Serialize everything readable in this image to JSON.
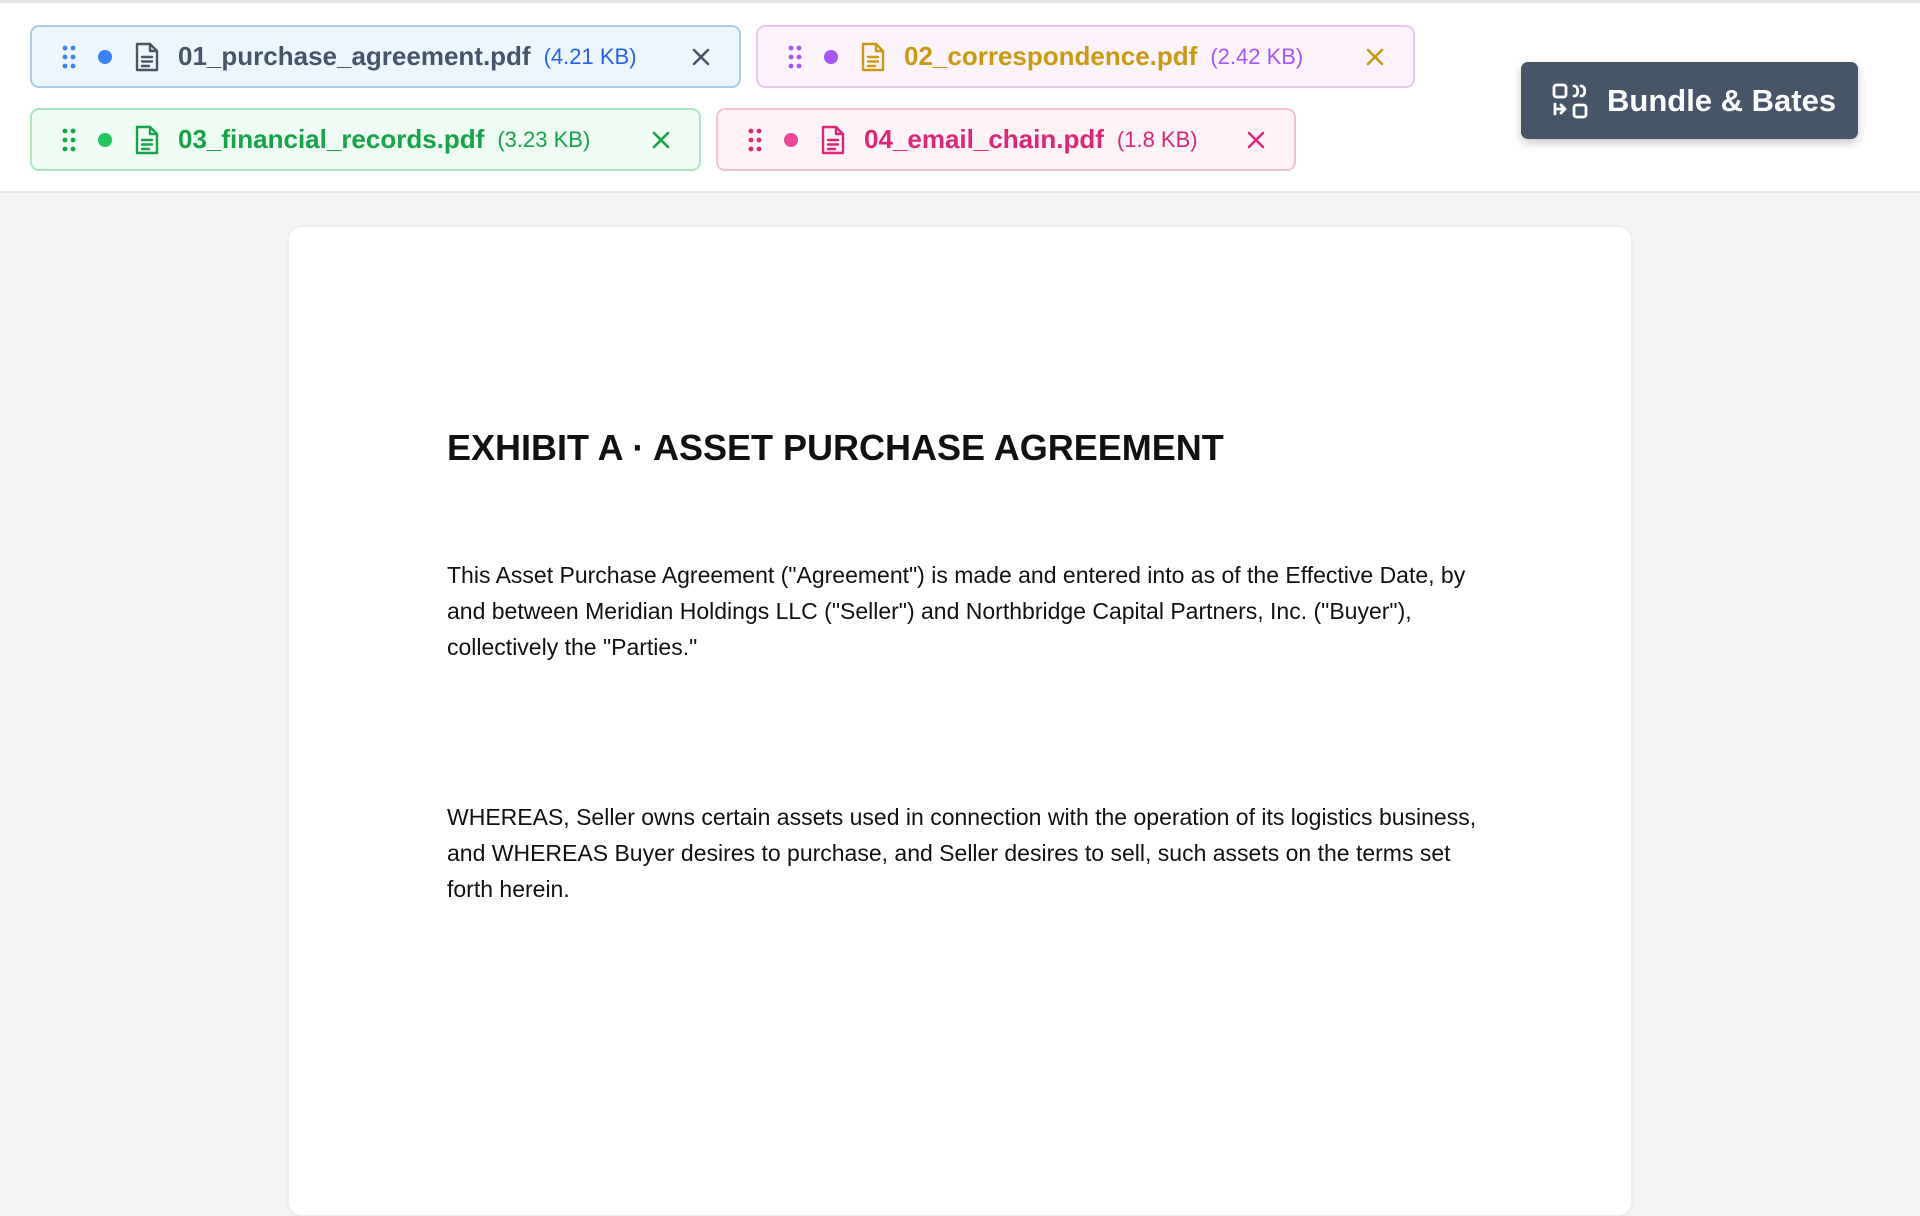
{
  "tabs": [
    {
      "name": "01_purchase_agreement.pdf",
      "size": "(4.21 KB)",
      "colors": {
        "bg": "#eef6fd",
        "border": "#a9cdee",
        "grip": "#3b82f6",
        "dot": "#3b82f6",
        "icon": "#4b5563",
        "name": "#475569",
        "size": "#2563eb",
        "close": "#475569"
      }
    },
    {
      "name": "02_correspondence.pdf",
      "size": "(2.42 KB)",
      "colors": {
        "bg": "#fcf3fd",
        "border": "#e9c7f0",
        "grip": "#a855f7",
        "dot": "#a855f7",
        "icon": "#ca9a12",
        "name": "#ca9a12",
        "size": "#a855f7",
        "close": "#ca9a12"
      }
    },
    {
      "name": "03_financial_records.pdf",
      "size": "(3.23 KB)",
      "colors": {
        "bg": "#effcf3",
        "border": "#a7e8bc",
        "grip": "#16a34a",
        "dot": "#22c55e",
        "icon": "#16a34a",
        "name": "#16a34a",
        "size": "#16a34a",
        "close": "#16a34a"
      }
    },
    {
      "name": "04_email_chain.pdf",
      "size": "(1.8 KB)",
      "colors": {
        "bg": "#fdf2f6",
        "border": "#f5c0d6",
        "grip": "#db2777",
        "dot": "#ec4899",
        "icon": "#db2777",
        "name": "#db2777",
        "size": "#db2777",
        "close": "#db2777"
      }
    }
  ],
  "action_button": {
    "label": "Bundle & Bates",
    "icon": "bundle-icon",
    "bg": "#475569"
  },
  "document": {
    "title": "EXHIBIT A · ASSET PURCHASE AGREEMENT",
    "paragraphs": [
      "This Asset Purchase Agreement (\"Agreement\") is made and entered into as of the Effective Date, by and between Meridian Holdings LLC (\"Seller\") and Northbridge Capital Partners, Inc. (\"Buyer\"), collectively the \"Parties.\"",
      "WHEREAS, Seller owns certain assets used in connection with the operation of its logistics business, and WHEREAS Buyer desires to purchase, and Seller desires to sell, such assets on the terms set forth herein."
    ]
  }
}
